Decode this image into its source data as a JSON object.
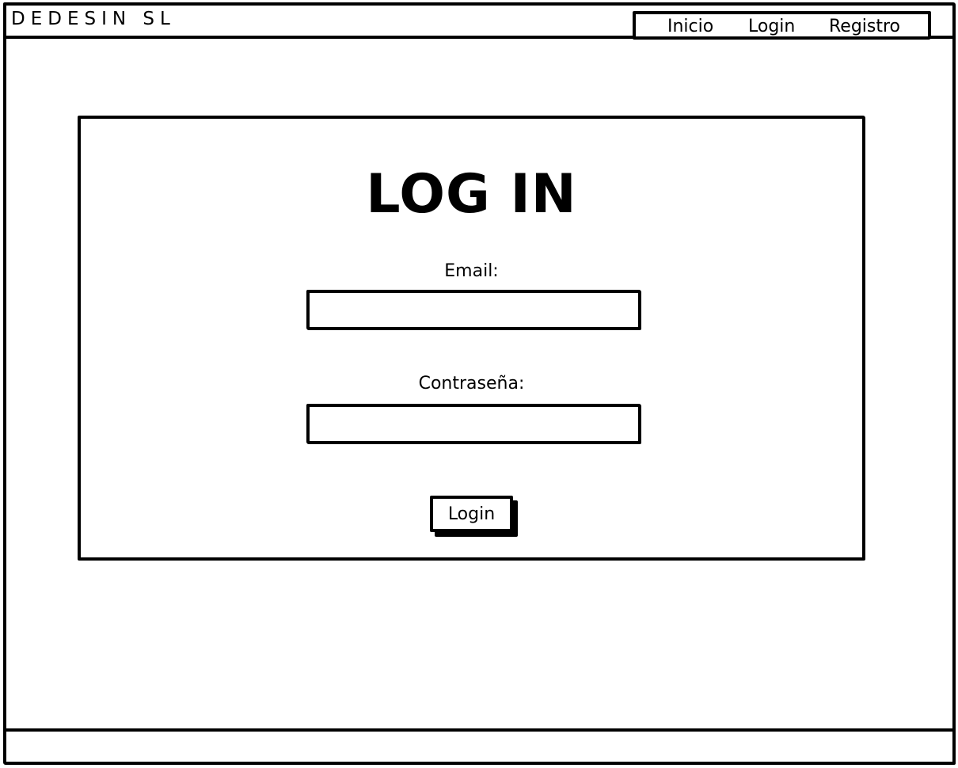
{
  "header": {
    "brand": "DEDESIN SL",
    "nav": [
      "Inicio",
      "Login",
      "Registro"
    ]
  },
  "login": {
    "title": "LOG IN",
    "email_label": "Email:",
    "password_label": "Contraseña:",
    "email_value": "",
    "password_value": "",
    "submit_label": "Login"
  }
}
